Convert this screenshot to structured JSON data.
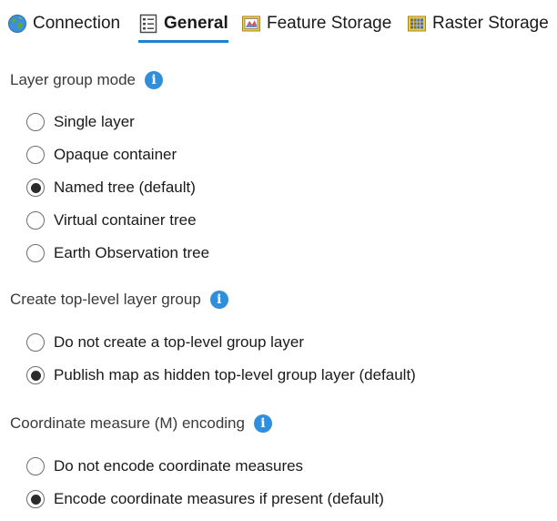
{
  "tabs": [
    {
      "label": "Connection",
      "icon": "globe-icon",
      "active": false
    },
    {
      "label": "General",
      "icon": "list-page-icon",
      "active": true
    },
    {
      "label": "Feature Storage",
      "icon": "feature-map-icon",
      "active": false
    },
    {
      "label": "Raster Storage",
      "icon": "raster-grid-icon",
      "active": false
    }
  ],
  "sections": [
    {
      "title": "Layer group mode",
      "options": [
        {
          "label": "Single layer",
          "selected": false
        },
        {
          "label": "Opaque container",
          "selected": false
        },
        {
          "label": "Named tree (default)",
          "selected": true
        },
        {
          "label": "Virtual container tree",
          "selected": false
        },
        {
          "label": "Earth Observation tree",
          "selected": false
        }
      ]
    },
    {
      "title": "Create top-level layer group",
      "options": [
        {
          "label": "Do not create a top-level group layer",
          "selected": false
        },
        {
          "label": "Publish map as hidden top-level group layer (default)",
          "selected": true
        }
      ]
    },
    {
      "title": "Coordinate measure (M) encoding",
      "options": [
        {
          "label": "Do not encode coordinate measures",
          "selected": false
        },
        {
          "label": "Encode coordinate measures if present (default)",
          "selected": true
        }
      ]
    }
  ],
  "info_glyph": "i",
  "colors": {
    "accent": "#1f7fd4",
    "info": "#2f8fdc"
  }
}
